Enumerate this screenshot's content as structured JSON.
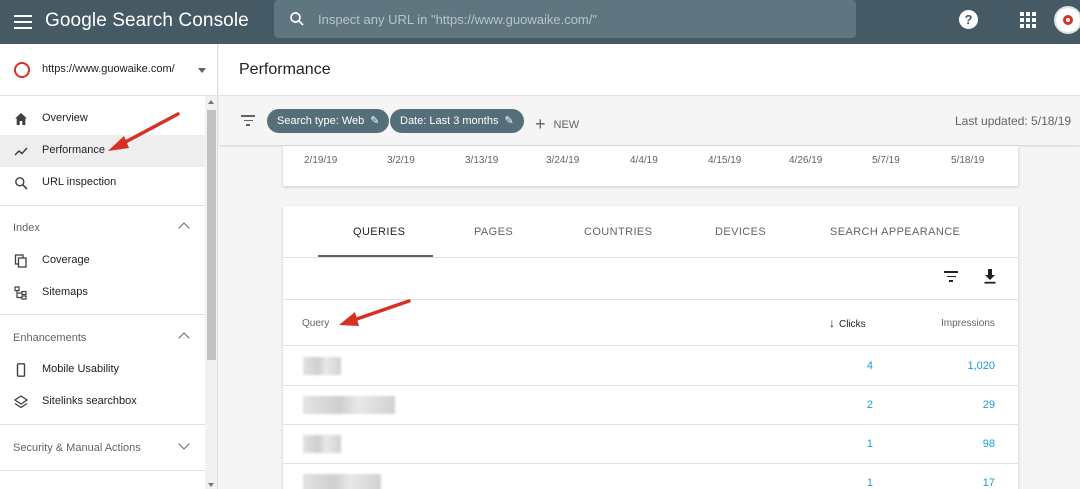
{
  "app": {
    "title": "Google Search Console"
  },
  "search": {
    "placeholder": "Inspect any URL in \"https://www.guowaike.com/\""
  },
  "header_icons": [
    "menu-icon",
    "search-icon",
    "help-icon",
    "apps-icon",
    "avatar"
  ],
  "property": {
    "url": "https://www.guowaike.com/"
  },
  "nav": {
    "overview": "Overview",
    "performance": "Performance",
    "url_inspection": "URL inspection"
  },
  "sections": {
    "index": {
      "label": "Index",
      "items": [
        "Coverage",
        "Sitemaps"
      ]
    },
    "enhancements": {
      "label": "Enhancements",
      "items": [
        "Mobile Usability",
        "Sitelinks searchbox"
      ]
    },
    "security": {
      "label": "Security & Manual Actions"
    }
  },
  "page": {
    "title": "Performance"
  },
  "filters": {
    "search_type": "Search type: Web",
    "date": "Date: Last 3 months",
    "new_label": "NEW",
    "last_updated": "Last updated: 5/18/19"
  },
  "chart": {
    "dates": [
      "2/19/19",
      "3/2/19",
      "3/13/19",
      "3/24/19",
      "4/4/19",
      "4/15/19",
      "4/26/19",
      "5/7/19",
      "5/18/19"
    ]
  },
  "tabs": [
    "QUERIES",
    "PAGES",
    "COUNTRIES",
    "DEVICES",
    "SEARCH APPEARANCE"
  ],
  "active_tab": "QUERIES",
  "table": {
    "columns": {
      "query": "Query",
      "clicks": "Clicks",
      "impressions": "Impressions"
    },
    "rows": [
      {
        "clicks": "4",
        "impressions": "1,020"
      },
      {
        "clicks": "2",
        "impressions": "29"
      },
      {
        "clicks": "1",
        "impressions": "98"
      },
      {
        "clicks": "1",
        "impressions": "17"
      }
    ]
  },
  "colors": {
    "topbar": "#455a64",
    "chip": "#546e7a",
    "link": "#1a9bd7",
    "annotation": "#d93025"
  }
}
